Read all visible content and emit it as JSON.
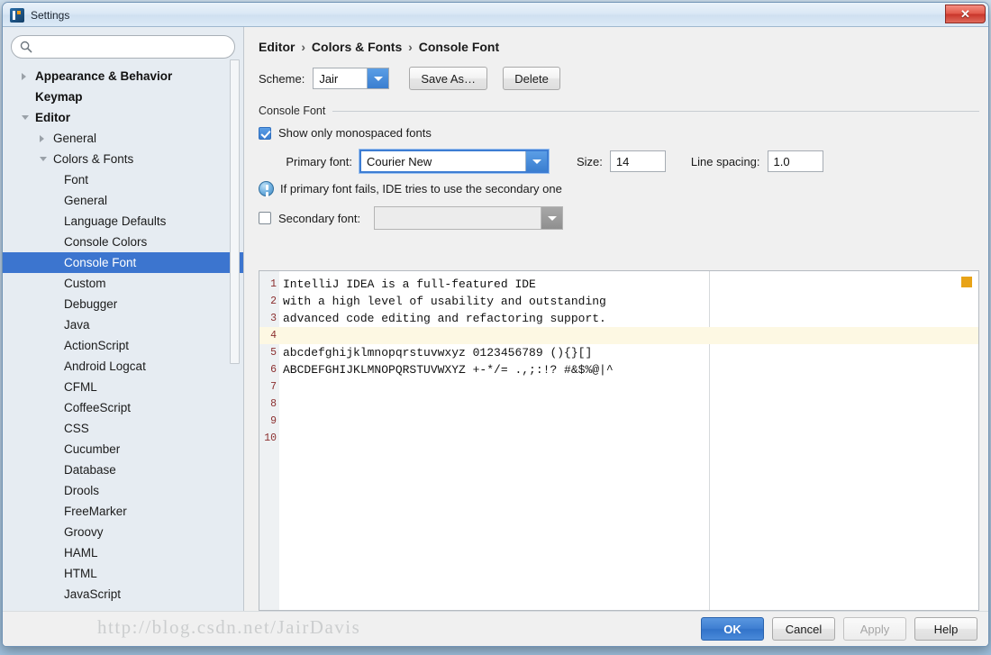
{
  "window": {
    "title": "Settings",
    "app_icon": "intellij-logo-icon",
    "close_label": "✕"
  },
  "sidebar": {
    "search": {
      "value": "",
      "placeholder": "",
      "icon": "search-icon"
    },
    "items": [
      {
        "label": "Appearance & Behavior",
        "level": 0,
        "twisty": "collapsed",
        "selected": false
      },
      {
        "label": "Keymap",
        "level": 0,
        "twisty": "none",
        "selected": false
      },
      {
        "label": "Editor",
        "level": 0,
        "twisty": "expanded",
        "selected": false
      },
      {
        "label": "General",
        "level": 1,
        "twisty": "collapsed",
        "selected": false
      },
      {
        "label": "Colors & Fonts",
        "level": 1,
        "twisty": "expanded",
        "selected": false
      },
      {
        "label": "Font",
        "level": 2,
        "twisty": "none",
        "selected": false
      },
      {
        "label": "General",
        "level": 2,
        "twisty": "none",
        "selected": false
      },
      {
        "label": "Language Defaults",
        "level": 2,
        "twisty": "none",
        "selected": false
      },
      {
        "label": "Console Colors",
        "level": 2,
        "twisty": "none",
        "selected": false
      },
      {
        "label": "Console Font",
        "level": 2,
        "twisty": "none",
        "selected": true
      },
      {
        "label": "Custom",
        "level": 2,
        "twisty": "none",
        "selected": false
      },
      {
        "label": "Debugger",
        "level": 2,
        "twisty": "none",
        "selected": false
      },
      {
        "label": "Java",
        "level": 2,
        "twisty": "none",
        "selected": false
      },
      {
        "label": "ActionScript",
        "level": 2,
        "twisty": "none",
        "selected": false
      },
      {
        "label": "Android Logcat",
        "level": 2,
        "twisty": "none",
        "selected": false
      },
      {
        "label": "CFML",
        "level": 2,
        "twisty": "none",
        "selected": false
      },
      {
        "label": "CoffeeScript",
        "level": 2,
        "twisty": "none",
        "selected": false
      },
      {
        "label": "CSS",
        "level": 2,
        "twisty": "none",
        "selected": false
      },
      {
        "label": "Cucumber",
        "level": 2,
        "twisty": "none",
        "selected": false
      },
      {
        "label": "Database",
        "level": 2,
        "twisty": "none",
        "selected": false
      },
      {
        "label": "Drools",
        "level": 2,
        "twisty": "none",
        "selected": false
      },
      {
        "label": "FreeMarker",
        "level": 2,
        "twisty": "none",
        "selected": false
      },
      {
        "label": "Groovy",
        "level": 2,
        "twisty": "none",
        "selected": false
      },
      {
        "label": "HAML",
        "level": 2,
        "twisty": "none",
        "selected": false
      },
      {
        "label": "HTML",
        "level": 2,
        "twisty": "none",
        "selected": false
      },
      {
        "label": "JavaScript",
        "level": 2,
        "twisty": "none",
        "selected": false
      }
    ]
  },
  "content": {
    "breadcrumb": {
      "part1": "Editor",
      "part2": "Colors & Fonts",
      "part3": "Console Font",
      "separator": "›"
    },
    "scheme": {
      "label": "Scheme:",
      "value": "Jair",
      "save_as_label": "Save As…",
      "delete_label": "Delete"
    },
    "group": {
      "title": "Console Font"
    },
    "monospaced": {
      "label": "Show only monospaced fonts",
      "checked": true
    },
    "primary_font": {
      "label": "Primary font:",
      "value": "Courier New"
    },
    "size": {
      "label": "Size:",
      "value": "14"
    },
    "line_spacing": {
      "label": "Line spacing:",
      "value": "1.0"
    },
    "hint": {
      "icon": "info-icon",
      "text": "If primary font fails, IDE tries to use the secondary one"
    },
    "secondary_font": {
      "label": "Secondary font:",
      "checked": false,
      "value": ""
    }
  },
  "preview": {
    "caret_line": 4,
    "marker_color": "#e8a317",
    "lines": [
      {
        "num": "1",
        "text": "IntelliJ IDEA is a full-featured IDE"
      },
      {
        "num": "2",
        "text": "with a high level of usability and outstanding"
      },
      {
        "num": "3",
        "text": "advanced code editing and refactoring support."
      },
      {
        "num": "4",
        "text": ""
      },
      {
        "num": "5",
        "text": "abcdefghijklmnopqrstuvwxyz 0123456789 (){}[]"
      },
      {
        "num": "6",
        "text": "ABCDEFGHIJKLMNOPQRSTUVWXYZ +-*/= .,;:!? #&$%@|^"
      },
      {
        "num": "7",
        "text": ""
      },
      {
        "num": "8",
        "text": ""
      },
      {
        "num": "9",
        "text": ""
      },
      {
        "num": "10",
        "text": ""
      }
    ]
  },
  "footer": {
    "ok": "OK",
    "cancel": "Cancel",
    "apply": "Apply",
    "help": "Help",
    "watermark": "http://blog.csdn.net/JairDavis"
  },
  "colors": {
    "accent": "#3c75cf",
    "selection": "#3c75cf",
    "line_number": "#8b2f2f",
    "caret_row": "#fdf8e3",
    "marker": "#e8a317"
  }
}
